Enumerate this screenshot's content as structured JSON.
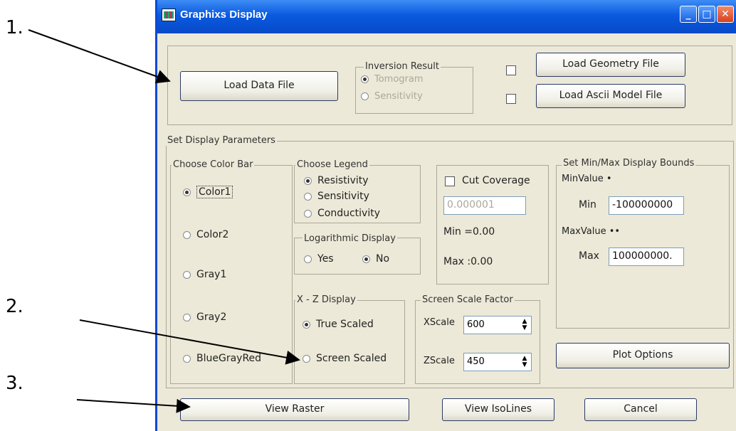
{
  "annotations": {
    "n1": "1.",
    "n2": "2.",
    "n3": "3."
  },
  "window": {
    "title": "Graphixs Display",
    "min": "_",
    "max": "□",
    "close": "✕"
  },
  "top": {
    "load_data": "Load Data File",
    "inversion": {
      "label": "Inversion Result",
      "tomogram": "Tomogram",
      "sensitivity": "Sensitivity"
    },
    "load_geometry": "Load Geometry File",
    "load_ascii": "Load Ascii Model File"
  },
  "params": {
    "label": "Set Display Parameters",
    "color_bar": {
      "label": "Choose Color Bar",
      "options": [
        "Color1",
        "Color2",
        "Gray1",
        "Gray2",
        "BlueGrayRed"
      ]
    },
    "legend": {
      "label": "Choose Legend",
      "options": [
        "Resistivity",
        "Sensitivity",
        "Conductivity"
      ]
    },
    "log_display": {
      "label": "Logarithmic Display",
      "yes": "Yes",
      "no": "No"
    },
    "xz_display": {
      "label": "X - Z Display",
      "true_scaled": "True Scaled",
      "screen_scaled": "Screen Scaled"
    },
    "cut_coverage": {
      "label": "Cut Coverage",
      "value": "0.000001",
      "min": "Min =0.00",
      "max": "Max :0.00"
    },
    "screen_scale": {
      "label": "Screen Scale Factor",
      "xscale_label": "XScale",
      "xscale_value": "600",
      "zscale_label": "ZScale",
      "zscale_value": "450"
    },
    "bounds": {
      "label": "Set Min/Max Display Bounds",
      "minvalue_label": "MinValue •",
      "min_label": "Min",
      "min_value": "-100000000",
      "maxvalue_label": "MaxValue ••",
      "max_label": "Max",
      "max_value": "100000000."
    },
    "plot_options": "Plot Options"
  },
  "bottom": {
    "view_raster": "View Raster",
    "view_isolines": "View IsoLines",
    "cancel": "Cancel"
  }
}
